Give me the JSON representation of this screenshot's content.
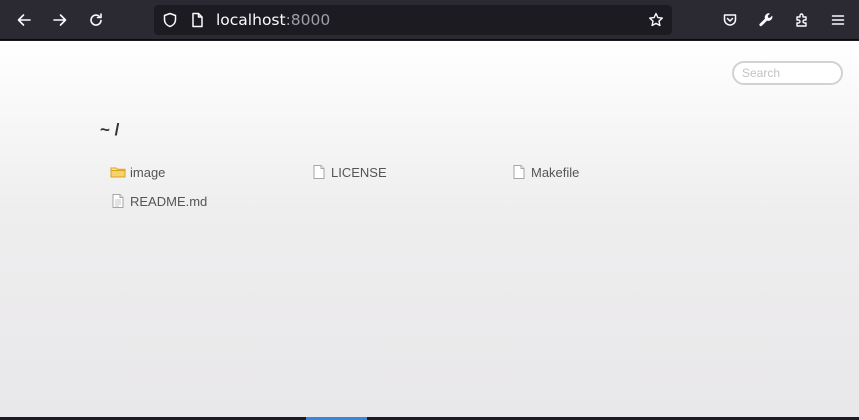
{
  "browser": {
    "url_host": "localhost",
    "url_port": ":8000",
    "icons": {
      "back": "arrow-left-icon",
      "forward": "arrow-right-icon",
      "reload": "reload-icon",
      "tracking": "shield-icon",
      "page_info": "page-icon",
      "bookmark": "star-icon",
      "pocket": "pocket-icon",
      "tools": "wrench-icon",
      "extensions": "puzzle-icon",
      "menu": "hamburger-menu-icon"
    }
  },
  "page": {
    "search_placeholder": "Search",
    "breadcrumb": "~ /",
    "files": [
      {
        "name": "image",
        "type": "folder"
      },
      {
        "name": "LICENSE",
        "type": "file"
      },
      {
        "name": "Makefile",
        "type": "file"
      },
      {
        "name": "README.md",
        "type": "text-file"
      }
    ]
  },
  "colors": {
    "toolbar_bg": "#2b2a33",
    "urlbar_bg": "#1c1b22",
    "folder_yellow": "#f4c542",
    "text": "#555555"
  }
}
